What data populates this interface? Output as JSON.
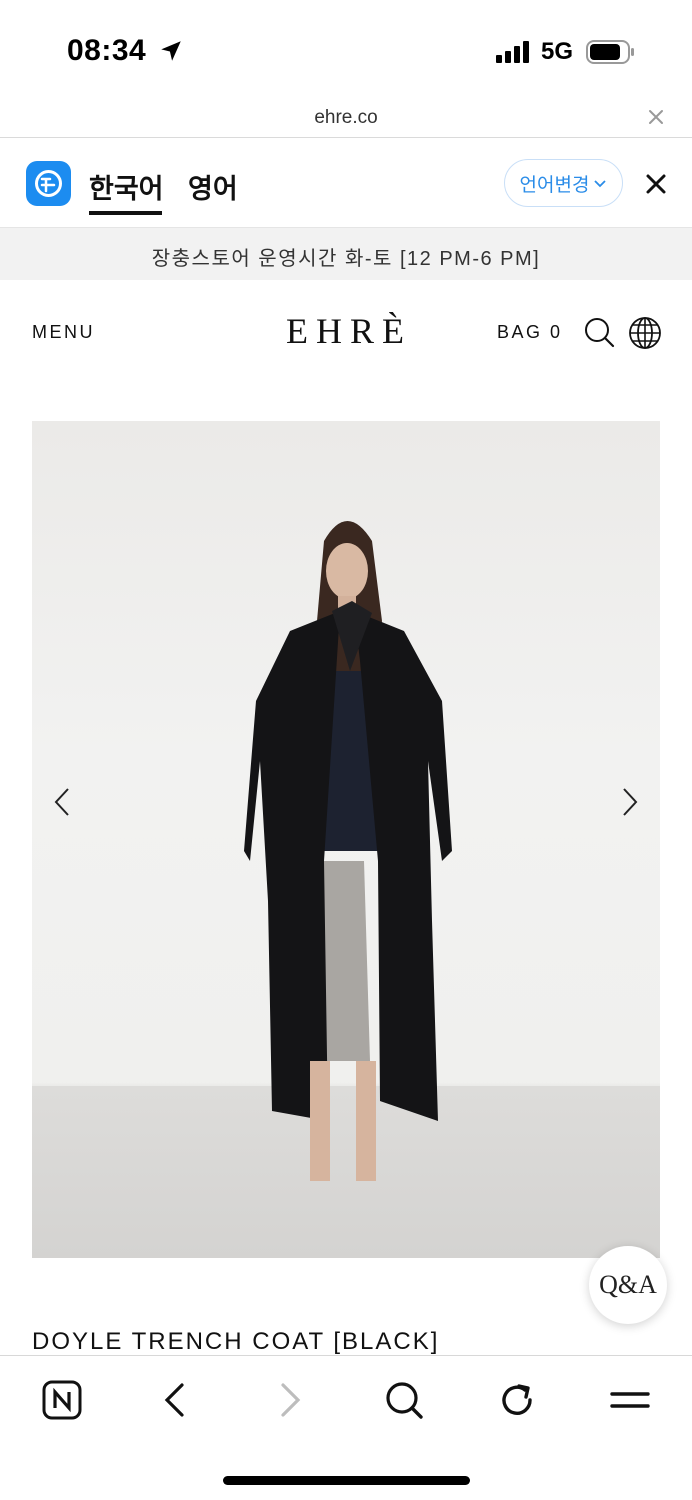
{
  "status_bar": {
    "time": "08:34",
    "network": "5G",
    "icons": [
      "location-arrow-icon",
      "signal-bars-icon",
      "battery-icon"
    ]
  },
  "url_bar": {
    "domain": "ehre.co"
  },
  "translate_bar": {
    "source_lang": "한국어",
    "target_lang": "영어",
    "change_label": "언어변경",
    "active_tab": "한국어",
    "accent_color": "#2a8ce8"
  },
  "announcement": {
    "text": "장충스토어 운영시간 화-토 [12 PM-6 PM]"
  },
  "site_header": {
    "menu_label": "MENU",
    "logo": "EHRÈ",
    "bag_label": "BAG 0"
  },
  "product": {
    "title": "DOYLE TRENCH COAT [BLACK]"
  },
  "qa_button": {
    "label": "Q&A"
  },
  "browser_toolbar": {
    "items": [
      "naver-icon",
      "back-icon",
      "forward-icon",
      "search-icon",
      "reload-icon",
      "menu-icon"
    ]
  }
}
